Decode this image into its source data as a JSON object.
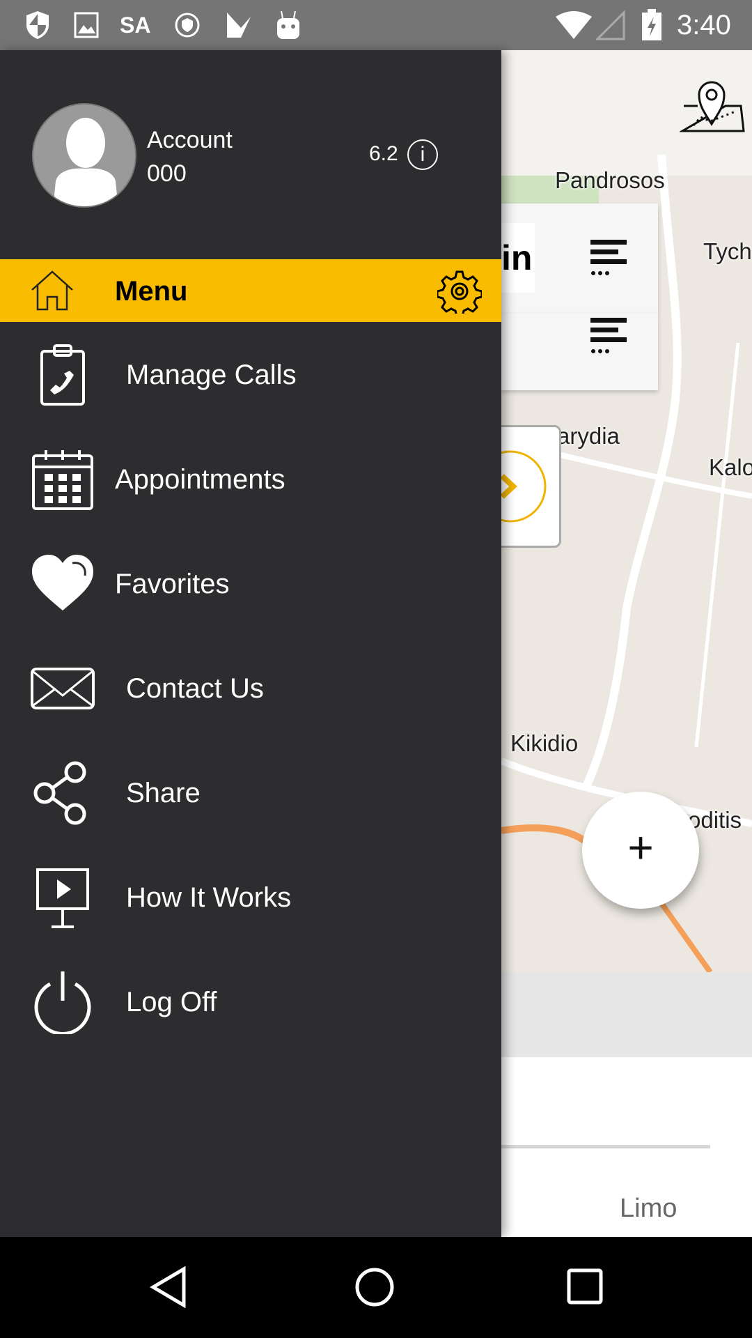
{
  "status_bar": {
    "carrier_text": "SA",
    "time": "3:40",
    "icons": [
      "shield-icon",
      "image-icon",
      "vpn-icon",
      "task-icon",
      "android-icon",
      "wifi-icon",
      "signal-icon",
      "battery-charging-icon"
    ]
  },
  "drawer": {
    "account_label": "Account",
    "account_number": "000",
    "version": "6.2",
    "menu_header": {
      "label": "Menu",
      "color": "#f9bc00"
    },
    "items": [
      {
        "label": "Manage Calls",
        "icon": "clipboard-phone-icon"
      },
      {
        "label": "Appointments",
        "icon": "calendar-icon"
      },
      {
        "label": "Favorites",
        "icon": "heart-icon"
      },
      {
        "label": "Contact Us",
        "icon": "envelope-icon"
      },
      {
        "label": "Share",
        "icon": "share-icon"
      },
      {
        "label": "How It Works",
        "icon": "presentation-icon"
      },
      {
        "label": "Log Off",
        "icon": "power-icon"
      }
    ]
  },
  "map": {
    "labels": [
      "Pandrosos",
      "Tych",
      "Karydia",
      "Kalo",
      "Kikidio",
      "oditis"
    ],
    "partial_text": "in",
    "fab": "+"
  },
  "bottom": {
    "tab_label": "Limo"
  }
}
